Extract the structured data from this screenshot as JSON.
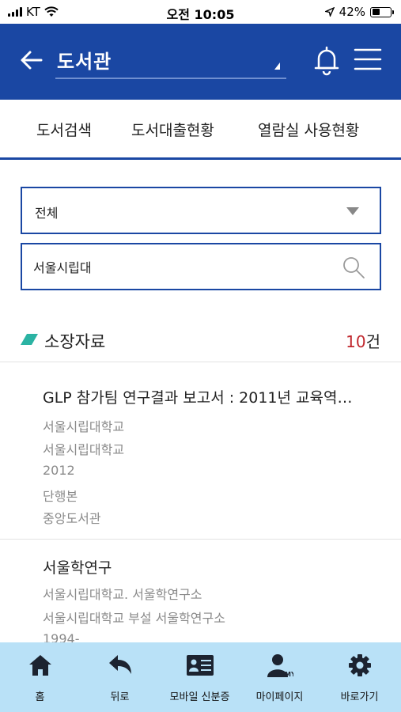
{
  "status_bar": {
    "carrier": "KT",
    "time": "오전 10:05",
    "battery": "42%",
    "battery_level": 0.42
  },
  "header": {
    "title": "도서관"
  },
  "tabs": [
    {
      "label": "도서검색"
    },
    {
      "label": "도서대출현황"
    },
    {
      "label": "열람실 사용현황"
    }
  ],
  "filter": {
    "selected": "전체"
  },
  "search": {
    "value": "서울시립대",
    "placeholder": ""
  },
  "section": {
    "title": "소장자료",
    "count": "10",
    "count_unit": "건"
  },
  "results": [
    {
      "title": "GLP 참가팀 연구결과 보고서 : 2011년 교육역…",
      "lines": [
        "서울시립대학교",
        "서울시립대학교",
        "2012",
        "단행본",
        "중앙도서관"
      ]
    },
    {
      "title": "서울학연구",
      "lines": [
        "서울시립대학교. 서울학연구소",
        "서울시립대학교 부설 서울학연구소",
        "1994-"
      ]
    }
  ],
  "bottom_nav": [
    {
      "label": "홈",
      "icon": "home-icon"
    },
    {
      "label": "뒤로",
      "icon": "back-icon"
    },
    {
      "label": "모바일 신분증",
      "icon": "id-card-icon"
    },
    {
      "label": "마이페이지",
      "icon": "my-page-icon"
    },
    {
      "label": "바로가기",
      "icon": "gear-icon"
    }
  ],
  "colors": {
    "primary": "#1a47a3",
    "nav_bg": "#b9e1f7",
    "count_accent": "#c0272d",
    "section_mark": "#2bb3a3"
  }
}
